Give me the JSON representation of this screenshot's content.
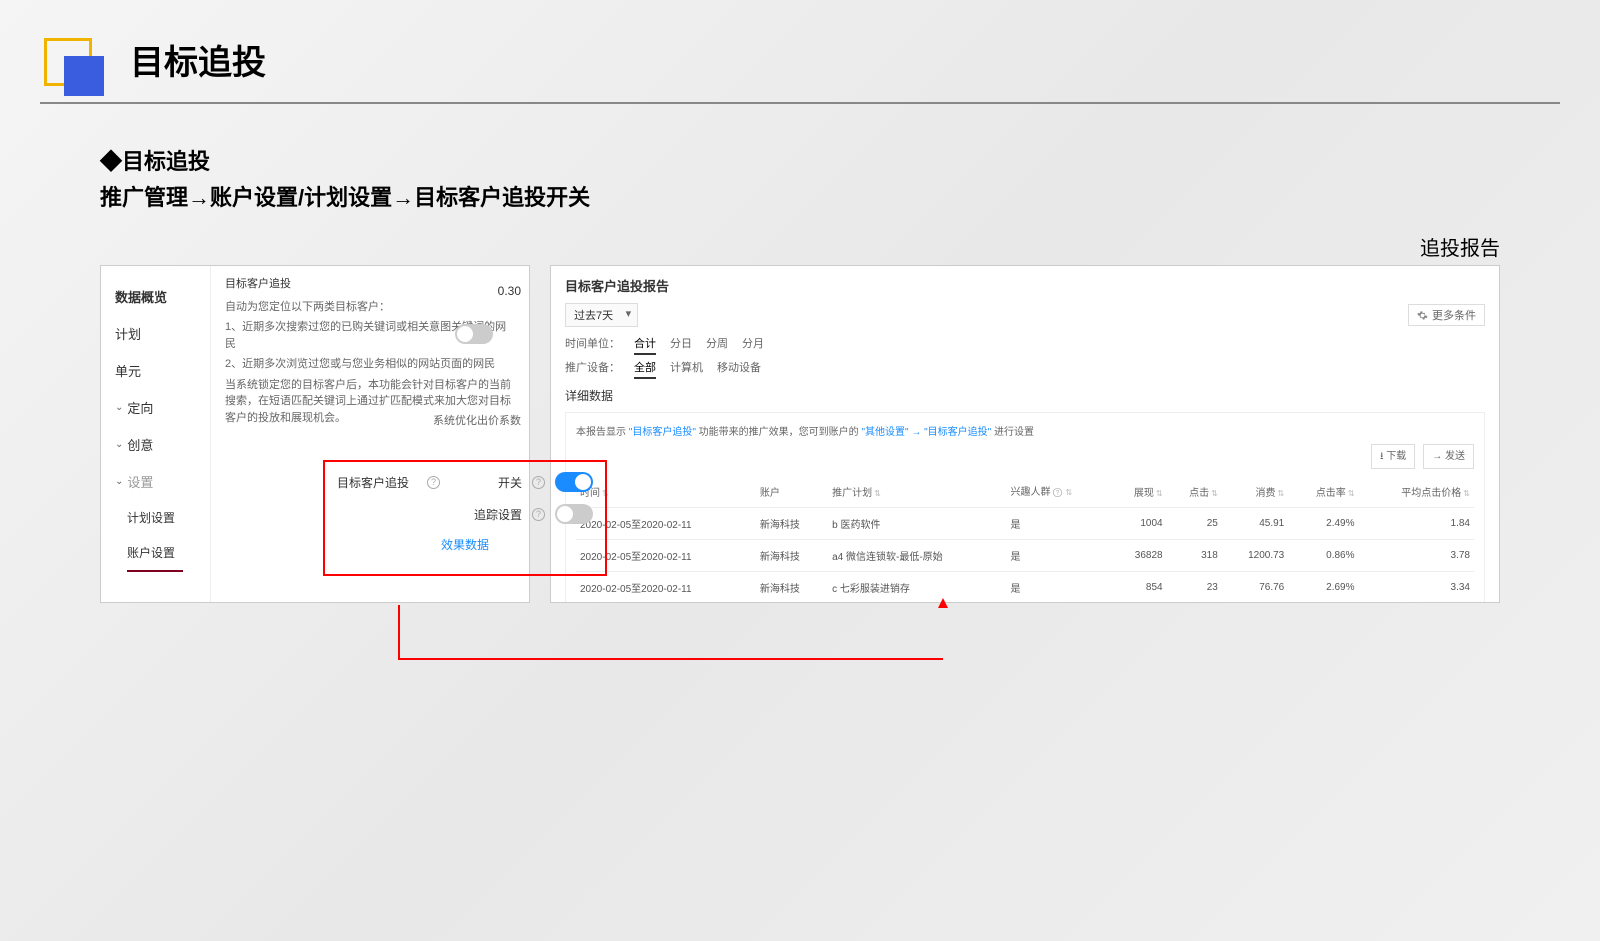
{
  "header": {
    "title": "目标追投"
  },
  "subhead": {
    "line1": "◆目标追投",
    "line2": "推广管理→账户设置/计划设置→目标客户追投开关"
  },
  "report_label": "追投报告",
  "sidebar": {
    "items": [
      {
        "label": "数据概览",
        "active": true
      },
      {
        "label": "计划"
      },
      {
        "label": "单元"
      },
      {
        "label": "定向",
        "chev": true
      },
      {
        "label": "创意",
        "chev": true
      },
      {
        "label": "设置",
        "chev": true,
        "muted": true
      },
      {
        "label": "计划设置",
        "sub": true
      },
      {
        "label": "账户设置",
        "sub": true,
        "underline": true
      }
    ]
  },
  "tooltip": {
    "title": "目标客户追投",
    "intro": "自动为您定位以下两类目标客户：",
    "p1": "1、近期多次搜索过您的已购关键词或相关意图关键词的网民",
    "p2": "2、近期多次浏览过您或与您业务相似的网站页面的网民",
    "p3": "当系统锁定您的目标客户后，本功能会针对目标客户的当前搜索，在短语匹配关键词上通过扩匹配模式来加大您对目标客户的投放和展现机会。"
  },
  "value_030": "0.30",
  "coef_label": "系统优化出价系数",
  "settings": {
    "title": "目标客户追投",
    "switch_label": "开关",
    "track_label": "追踪设置",
    "data_link": "效果数据"
  },
  "report": {
    "title": "目标客户追投报告",
    "date_select": "过去7天",
    "more": "更多条件",
    "time_unit_label": "时间单位：",
    "time_tabs": [
      "合计",
      "分日",
      "分周",
      "分月"
    ],
    "device_label": "推广设备：",
    "device_tabs": [
      "全部",
      "计算机",
      "移动设备"
    ],
    "detail_label": "详细数据",
    "desc_prefix": "本报告显示",
    "desc_q1": "\"目标客户追投\"",
    "desc_mid": "功能带来的推广效果，您可到账户的",
    "desc_q2": "\"其他设置\"",
    "desc_arrow": "→",
    "desc_q3": "\"目标客户追投\"",
    "desc_suffix": "进行设置",
    "download": "下载",
    "send": "发送",
    "columns": [
      "时间",
      "账户",
      "推广计划",
      "兴趣人群",
      "展现",
      "点击",
      "消费",
      "点击率",
      "平均点击价格"
    ],
    "rows": [
      {
        "time": "2020-02-05至2020-02-11",
        "account": "新海科技",
        "plan": "b 医药软件",
        "crowd": "是",
        "impr": "1004",
        "click": "25",
        "cost": "45.91",
        "ctr": "2.49%",
        "cpc": "1.84"
      },
      {
        "time": "2020-02-05至2020-02-11",
        "account": "新海科技",
        "plan": "a4 微信连锁软-最低-原始",
        "crowd": "是",
        "impr": "36828",
        "click": "318",
        "cost": "1200.73",
        "ctr": "0.86%",
        "cpc": "3.78"
      },
      {
        "time": "2020-02-05至2020-02-11",
        "account": "新海科技",
        "plan": "c 七彩服装进销存",
        "crowd": "是",
        "impr": "854",
        "click": "23",
        "cost": "76.76",
        "ctr": "2.69%",
        "cpc": "3.34"
      }
    ]
  }
}
